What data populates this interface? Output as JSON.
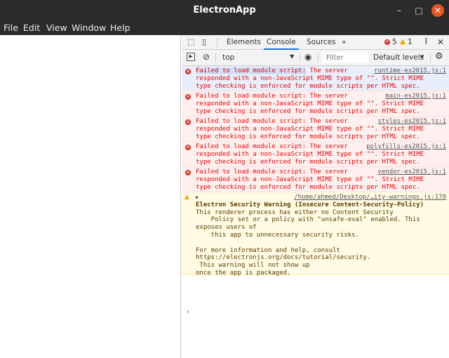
{
  "window": {
    "title": "ElectronApp",
    "minimize": "–",
    "maximize": "□",
    "close": "✕"
  },
  "menu": [
    "File",
    "Edit",
    "View",
    "Window",
    "Help"
  ],
  "devtools": {
    "tabs": [
      "Elements",
      "Console",
      "Sources"
    ],
    "more": "»",
    "error_count": "5",
    "warning_count": "1",
    "context": "top",
    "filter_placeholder": "Filter",
    "levels": "Default levels"
  },
  "messages": [
    {
      "text_a": "Failed to load module script:",
      "text_b": " The server\nresponded with a non-JavaScript MIME type of \"\". Strict MIME\ntype checking is enforced for module scripts per HTML spec.",
      "source": "runtime-es2015.js:1"
    },
    {
      "text_a": "Failed to load module script:",
      "text_b": " The server\nresponded with a non-JavaScript MIME type of \"\". Strict MIME\ntype checking is enforced for module scripts per HTML spec.",
      "source": "main-es2015.js:1"
    },
    {
      "text_a": "Failed to load module script:",
      "text_b": " The server\nresponded with a non-JavaScript MIME type of \"\". Strict MIME\ntype checking is enforced for module scripts per HTML spec.",
      "source": "styles-es2015.js:1"
    },
    {
      "text_a": "Failed to load module script:",
      "text_b": " The server\nresponded with a non-JavaScript MIME type of \"\". Strict MIME\ntype checking is enforced for module scripts per HTML spec.",
      "source": "polyfills-es2015.js:1"
    },
    {
      "text_a": "Failed to load module script:",
      "text_b": " The server\nresponded with a non-JavaScript MIME type of \"\". Strict MIME\ntype checking is enforced for module scripts per HTML spec.",
      "source": "vendor-es2015.js:1"
    }
  ],
  "warning": {
    "source": "/home/ahmed/Desktop/…ity-warnings.js:170",
    "heading": "Electron Security Warning (Insecure Content-Security-Policy)",
    "body": "This renderer process has either no Content Security\n    Policy set or a policy with \"unsafe-eval\" enabled. This\nexposes users of\n    this app to unnecessary security risks.\n\nFor more information and help, consult",
    "link": "https://electronjs.org/docs/tutorial/security",
    "tail": ".\n This warning will not show up\nonce the app is packaged."
  },
  "prompt": "›"
}
